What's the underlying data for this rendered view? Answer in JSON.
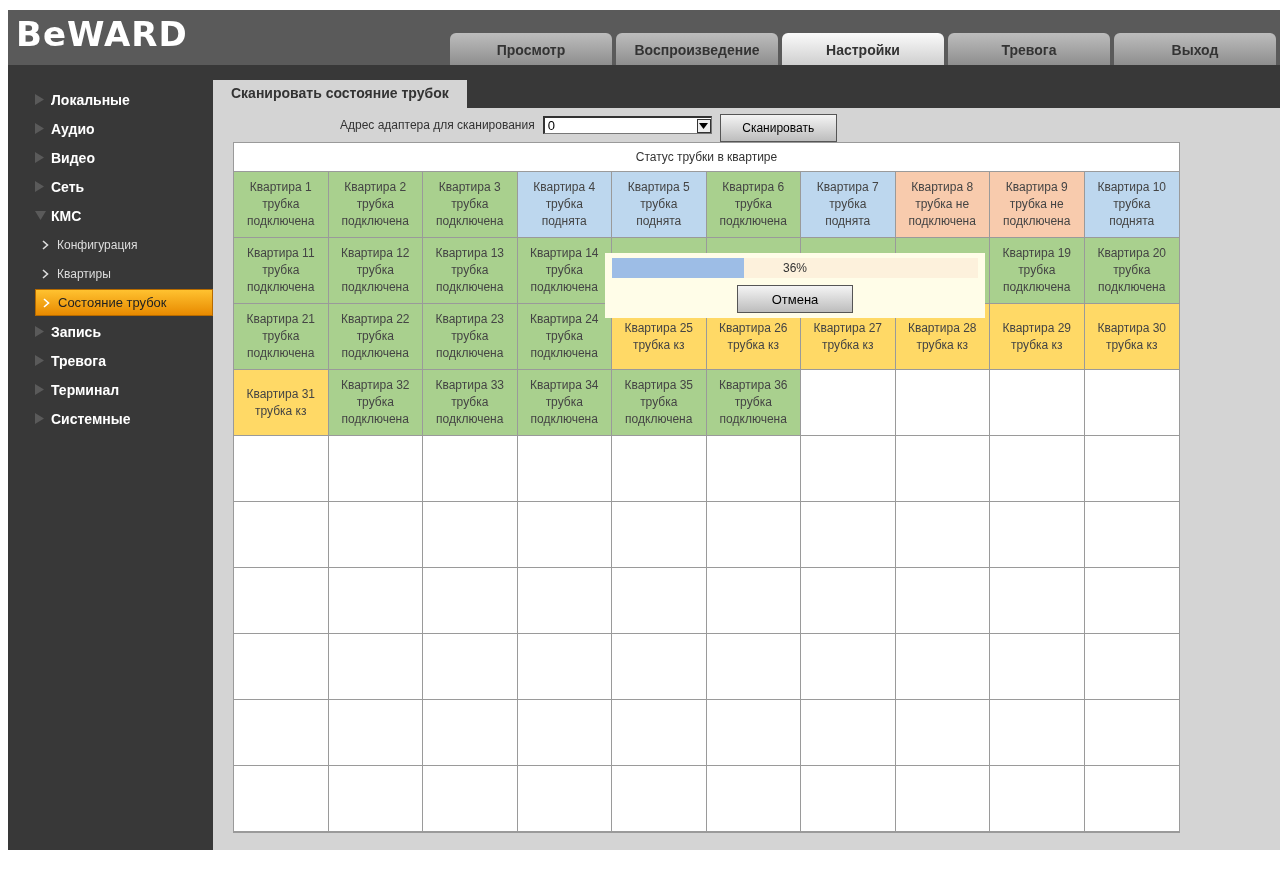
{
  "logo": "BeWARD",
  "tabs": [
    {
      "label": "Просмотр",
      "selected": false
    },
    {
      "label": "Воспроизведение",
      "selected": false
    },
    {
      "label": "Настройки",
      "selected": true
    },
    {
      "label": "Тревога",
      "selected": false
    },
    {
      "label": "Выход",
      "selected": false
    }
  ],
  "sidebar": {
    "items": [
      {
        "label": "Локальные",
        "expanded": false
      },
      {
        "label": "Аудио",
        "expanded": false
      },
      {
        "label": "Видео",
        "expanded": false
      },
      {
        "label": "Сеть",
        "expanded": false
      },
      {
        "label": "КМС",
        "expanded": true,
        "children": [
          {
            "label": "Конфигурация",
            "selected": false
          },
          {
            "label": "Квартиры",
            "selected": false
          },
          {
            "label": "Состояние трубок",
            "selected": true
          }
        ]
      },
      {
        "label": "Запись",
        "expanded": false
      },
      {
        "label": "Тревога",
        "expanded": false
      },
      {
        "label": "Терминал",
        "expanded": false
      },
      {
        "label": "Системные",
        "expanded": false
      }
    ]
  },
  "page_tab": "Сканировать состояние трубок",
  "scan": {
    "label": "Адрес адаптера для сканирования",
    "value": "0",
    "button": "Сканировать"
  },
  "table": {
    "title": "Статус трубки в квартире",
    "cells": [
      {
        "text": "Квартира 1\nтрубка\nподключена",
        "color": "#a9d08e"
      },
      {
        "text": "Квартира 2\nтрубка\nподключена",
        "color": "#a9d08e"
      },
      {
        "text": "Квартира 3\nтрубка\nподключена",
        "color": "#a9d08e"
      },
      {
        "text": "Квартира 4\nтрубка\nподнята",
        "color": "#bdd7ee"
      },
      {
        "text": "Квартира 5\nтрубка\nподнята",
        "color": "#bdd7ee"
      },
      {
        "text": "Квартира 6\nтрубка\nподключена",
        "color": "#a9d08e"
      },
      {
        "text": "Квартира 7\nтрубка\nподнята",
        "color": "#bdd7ee"
      },
      {
        "text": "Квартира 8\nтрубка не\nподключена",
        "color": "#f8cbad"
      },
      {
        "text": "Квартира 9\nтрубка не\nподключена",
        "color": "#f8cbad"
      },
      {
        "text": "Квартира 10\nтрубка\nподнята",
        "color": "#bdd7ee"
      },
      {
        "text": "Квартира 11\nтрубка\nподключена",
        "color": "#a9d08e"
      },
      {
        "text": "Квартира 12\nтрубка\nподключена",
        "color": "#a9d08e"
      },
      {
        "text": "Квартира 13\nтрубка\nподключена",
        "color": "#a9d08e"
      },
      {
        "text": "Квартира 14\nтрубка\nподключена",
        "color": "#a9d08e"
      },
      {
        "color": "#a9d08e"
      },
      {
        "color": "#a9d08e"
      },
      {
        "color": "#a9d08e"
      },
      {
        "color": "#a9d08e"
      },
      {
        "text": "Квартира 19\nтрубка\nподключена",
        "color": "#a9d08e"
      },
      {
        "text": "Квартира 20\nтрубка\nподключена",
        "color": "#a9d08e"
      },
      {
        "text": "Квартира 21\nтрубка\nподключена",
        "color": "#a9d08e"
      },
      {
        "text": "Квартира 22\nтрубка\nподключена",
        "color": "#a9d08e"
      },
      {
        "text": "Квартира 23\nтрубка\nподключена",
        "color": "#a9d08e"
      },
      {
        "text": "Квартира 24\nтрубка\nподключена",
        "color": "#a9d08e"
      },
      {
        "text": "Квартира 25\nтрубка кз",
        "color": "#ffd966"
      },
      {
        "text": "Квартира 26\nтрубка кз",
        "color": "#ffd966"
      },
      {
        "text": "Квартира 27\nтрубка кз",
        "color": "#ffd966"
      },
      {
        "text": "Квартира 28\nтрубка кз",
        "color": "#ffd966"
      },
      {
        "text": "Квартира 29\nтрубка кз",
        "color": "#ffd966"
      },
      {
        "text": "Квартира 30\nтрубка кз",
        "color": "#ffd966"
      },
      {
        "text": "Квартира 31\nтрубка кз",
        "color": "#ffd966"
      },
      {
        "text": "Квартира 32\nтрубка\nподключена",
        "color": "#a9d08e"
      },
      {
        "text": "Квартира 33\nтрубка\nподключена",
        "color": "#a9d08e"
      },
      {
        "text": "Квартира 34\nтрубка\nподключена",
        "color": "#a9d08e"
      },
      {
        "text": "Квартира 35\nтрубка\nподключена",
        "color": "#a9d08e"
      },
      {
        "text": "Квартира 36\nтрубка\nподключена",
        "color": "#a9d08e"
      }
    ]
  },
  "progress": {
    "level": 0.36,
    "reading": "36%",
    "button": "Отмена"
  }
}
